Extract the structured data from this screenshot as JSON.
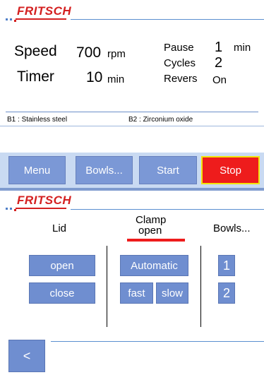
{
  "top": {
    "logo": "FRITSCH",
    "speed_label": "Speed",
    "speed_value": "700",
    "speed_unit": "rpm",
    "timer_label": "Timer",
    "timer_value": "10",
    "timer_unit": "min",
    "pause_label": "Pause",
    "pause_value": "1",
    "pause_unit": "min",
    "cycles_label": "Cycles",
    "cycles_value": "2",
    "revers_label": "Revers",
    "revers_value": "On",
    "b1": "B1 : Stainless steel",
    "b2": "B2 : Zirconium oxide"
  },
  "toolbar": {
    "menu": "Menu",
    "bowls": "Bowls...",
    "start": "Start",
    "stop": "Stop"
  },
  "bottom": {
    "logo": "FRITSCH",
    "lid_label": "Lid",
    "clamp_label_1": "Clamp",
    "clamp_label_2": "open",
    "bowls_label": "Bowls...",
    "open": "open",
    "close": "close",
    "automatic": "Automatic",
    "fast": "fast",
    "slow": "slow",
    "bowl_1": "1",
    "bowl_2": "2",
    "back": "<"
  },
  "colors": {
    "brand_red": "#d42020",
    "button_blue": "#6f8ed0",
    "stop_red": "#ee1c1c",
    "stop_border": "#f2e40b",
    "toolbar_bg": "#c9daf2"
  }
}
